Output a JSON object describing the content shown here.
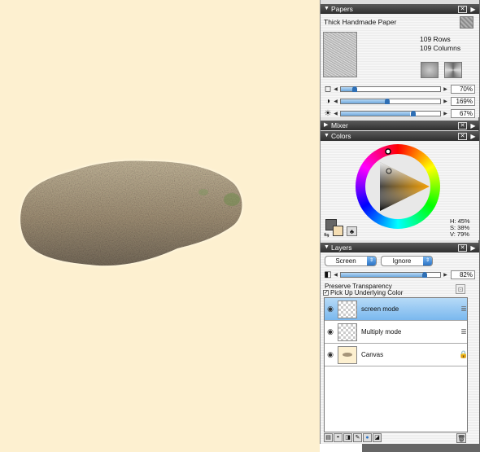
{
  "canvas": {
    "background": "#fdf0d0"
  },
  "papers": {
    "title": "Papers",
    "paper_name": "Thick Handmade Paper",
    "rows_text": "109 Rows",
    "columns_text": "109 Columns",
    "sliders": [
      {
        "icon": "paper-scale-icon",
        "value_text": "70%",
        "level": 0.07
      },
      {
        "icon": "contrast-icon",
        "value_text": "169%",
        "level": 0.45
      },
      {
        "icon": "brightness-icon",
        "value_text": "67%",
        "level": 0.7
      }
    ]
  },
  "mixer": {
    "title": "Mixer"
  },
  "colors": {
    "title": "Colors",
    "hue_text": "H: 45%",
    "saturation_text": "S: 38%",
    "value_text": "V: 79%",
    "main_color": "#9c8850",
    "additional_color": "#f5deb3"
  },
  "layers": {
    "title": "Layers",
    "composite_method": "Screen",
    "composite_depth": "Ignore",
    "opacity_text": "82%",
    "opacity_level": 0.82,
    "preserve_transparency_label": "Preserve Transparency",
    "pick_up_color_label": "Pick Up Underlying Color",
    "items": [
      {
        "name": "screen mode",
        "selected": true
      },
      {
        "name": "Multiply mode",
        "selected": false
      },
      {
        "name": "Canvas",
        "selected": false
      }
    ]
  }
}
